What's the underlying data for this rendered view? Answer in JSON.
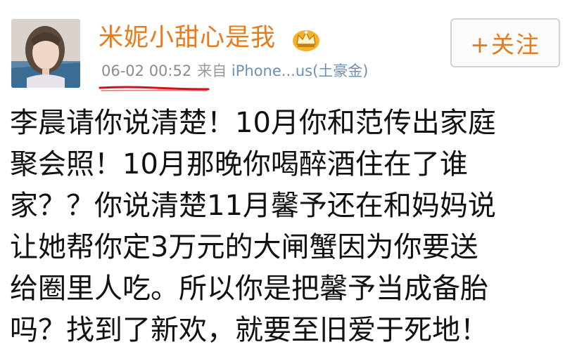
{
  "post": {
    "username": "米妮小甜心是我",
    "time": "06-02 00:52",
    "from_label": "来自",
    "source": "iPhone...us(土豪金)",
    "follow_label": "+关注",
    "text_lines": [
      "李晨请你说清楚！10月你和范传出家庭",
      "聚会照！10月那晚你喝醉酒住在了谁",
      "家？？你说清楚11月馨予还在和妈妈说",
      "让她帮你定3万元的大闸蟹因为你要送",
      "给圈里人吃。所以你是把馨予当成备胎",
      "吗？找到了新欢，就要至旧爱于死地！"
    ]
  },
  "icons": {
    "vip": "crown-badge-icon"
  },
  "colors": {
    "username": "#e87b1a",
    "meta": "#9a9a9a",
    "follow_text": "#e47b1e",
    "underline_mark": "#d6101a"
  }
}
